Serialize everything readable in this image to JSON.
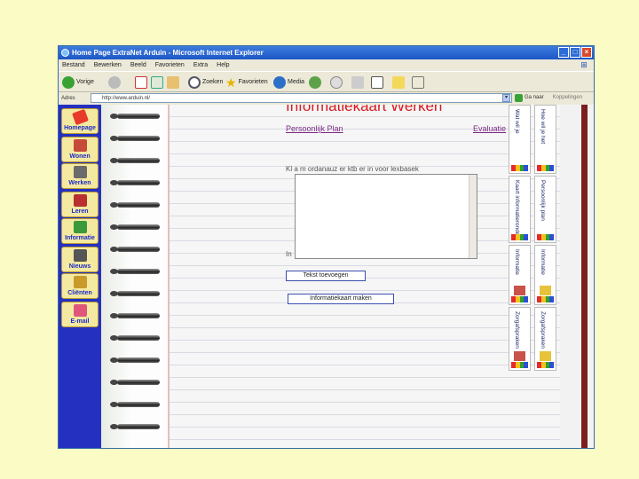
{
  "window": {
    "title": "Home Page ExtraNet Arduin - Microsoft Internet Explorer",
    "controls": [
      "_",
      "□",
      "×"
    ]
  },
  "menu": [
    "Bestand",
    "Bewerken",
    "Beeld",
    "Favorieten",
    "Extra",
    "Help"
  ],
  "toolbar": {
    "back": "Vorige",
    "search": "Zoeken",
    "favorites": "Favorieten",
    "media": "Media"
  },
  "address": {
    "label": "Adres",
    "url": "http://www.arduin.nl/",
    "go": "Ga naar",
    "links": "Koppelingen"
  },
  "nav": [
    "Homepage",
    "Wonen",
    "Werken",
    "Leren",
    "Informatie",
    "Nieuws",
    "Cliënten",
    "E-mail"
  ],
  "content": {
    "heading": "Informatiekaart Werken",
    "link_left": "Persoonlijk Plan",
    "link_right": "Evaluatie",
    "field_label": "Kl a m ordanauz er ktb er in voor lexbasek",
    "field_label2": "In",
    "btn_add": "Tekst toevoegen",
    "btn_info": "Informatiekaart maken"
  },
  "tabs": {
    "left": [
      "Wat wil je",
      "Kaart informatieronde",
      "Informatie",
      "Zorgafspraken"
    ],
    "right": [
      "Hoe wil je het",
      "Persoonlijk plan",
      "Informatie",
      "Zorgafspraken"
    ]
  },
  "colors": {
    "heading": "#d9191f",
    "nav_bg": "#2430c0",
    "nav_button": "#f4e9a0",
    "nav_label": "#1b2bc8",
    "link": "#7b2a86"
  }
}
